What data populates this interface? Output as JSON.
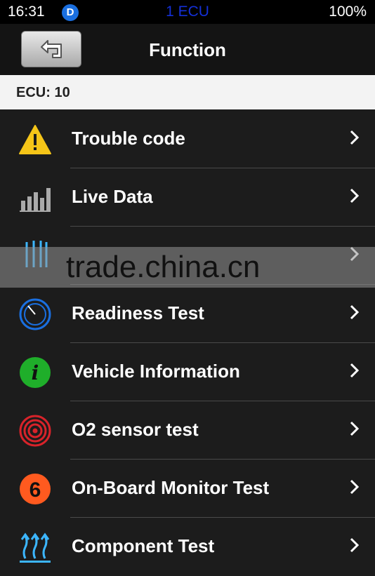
{
  "status": {
    "time": "16:31",
    "badge": "D",
    "center": "1 ECU",
    "battery": "100%"
  },
  "nav": {
    "title": "Function"
  },
  "ecu": {
    "label": "ECU: 10"
  },
  "menu": {
    "items": [
      {
        "label": "Trouble code",
        "icon": "warning-triangle-icon"
      },
      {
        "label": "Live Data",
        "icon": "bar-chart-icon"
      },
      {
        "label": "",
        "icon": "freeze-frame-icon"
      },
      {
        "label": "Readiness Test",
        "icon": "timer-dial-icon"
      },
      {
        "label": "Vehicle Information",
        "icon": "info-icon"
      },
      {
        "label": "O2 sensor test",
        "icon": "target-rings-icon"
      },
      {
        "label": "On-Board Monitor Test",
        "icon": "number-six-icon"
      },
      {
        "label": "Component Test",
        "icon": "heat-arrows-icon"
      }
    ]
  },
  "watermark": {
    "text": "trade.china.cn"
  },
  "colors": {
    "accent_blue": "#1a6fe0",
    "warning_yellow": "#f5c518",
    "info_green": "#1fae2a",
    "o2_red": "#d8232a",
    "monitor_orange": "#ff5a1f"
  }
}
